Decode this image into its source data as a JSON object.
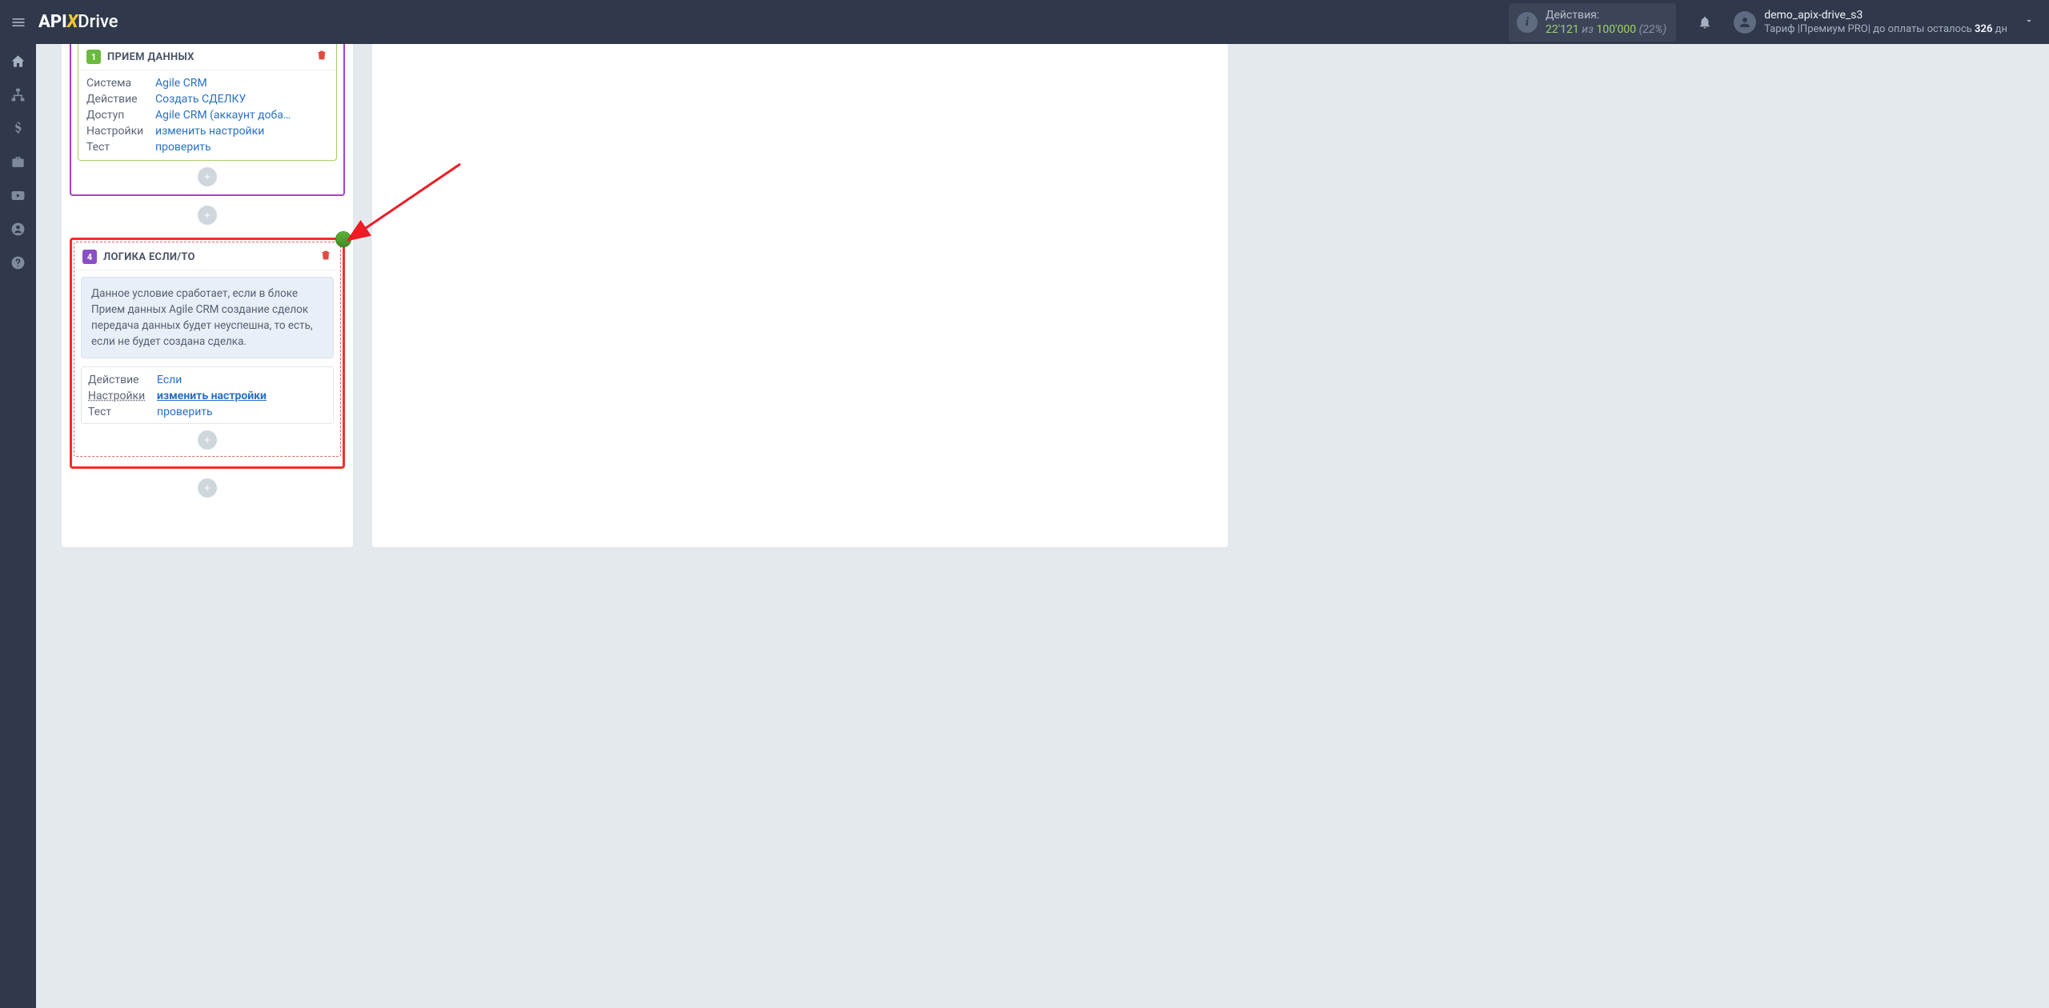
{
  "header": {
    "logo": {
      "api": "API",
      "x": "X",
      "drive": "Drive"
    },
    "actions": {
      "label": "Действия:",
      "used": "22'121",
      "of": "из",
      "total": "100'000",
      "percent": "(22%)"
    },
    "user": {
      "name": "demo_apix-drive_s3",
      "tariff_prefix": "Тариф |Премиум PRO| до оплаты осталось ",
      "days": "326",
      "days_suffix": " дн"
    }
  },
  "block1": {
    "badge": "1",
    "title": "ПРИЕМ ДАННЫХ",
    "rows": [
      {
        "key": "Система",
        "val": "Agile CRM"
      },
      {
        "key": "Действие",
        "val": "Создать СДЕЛКУ"
      },
      {
        "key": "Доступ",
        "val": "Agile CRM (аккаунт доба…"
      },
      {
        "key": "Настройки",
        "val": "изменить настройки"
      },
      {
        "key": "Тест",
        "val": "проверить"
      }
    ]
  },
  "block2": {
    "badge": "4",
    "title": "ЛОГИКА ЕСЛИ/ТО",
    "description": "Данное условие сработает, если в блоке Прием данных Agile CRM создание сделок передача данных будет неуспешна, то есть, если не будет создана сделка.",
    "rows": [
      {
        "key": "Действие",
        "val": "Если",
        "bold": false,
        "keyUnderline": false
      },
      {
        "key": "Настройки",
        "val": "изменить настройки",
        "bold": true,
        "keyUnderline": true
      },
      {
        "key": "Тест",
        "val": "проверить",
        "bold": false,
        "keyUnderline": false
      }
    ]
  }
}
